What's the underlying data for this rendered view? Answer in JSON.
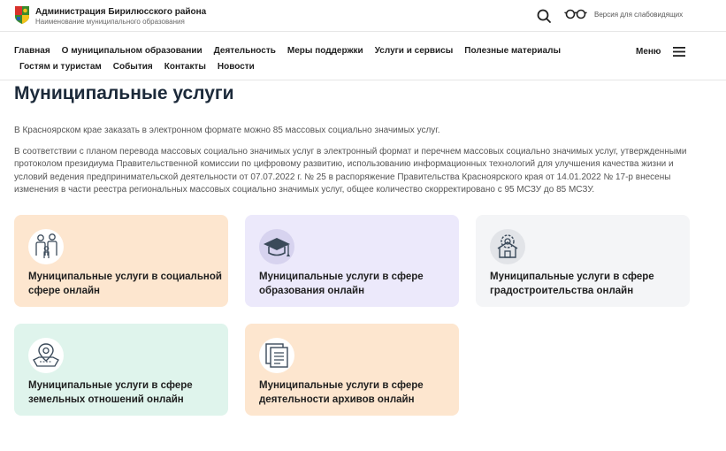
{
  "header": {
    "org_name": "Администрация Бирилюсского района",
    "org_subtitle": "Наименование муниципального образования",
    "accessibility_label": "Версия для слабовидящих"
  },
  "nav": {
    "row1": [
      "Главная",
      "О муниципальном образовании",
      "Деятельность",
      "Меры поддержки",
      "Услуги и сервисы",
      "Полезные материалы"
    ],
    "row2": [
      "Гостям и туристам",
      "События",
      "Контакты",
      "Новости"
    ],
    "menu_label": "Меню"
  },
  "main": {
    "title": "Муниципальные услуги",
    "intro": "В Красноярском крае заказать в электронном формате можно  85 массовых социально значимых услуг.",
    "paragraph": "В соответствии с планом перевода массовых социально значимых услуг в электронный формат и перечнем массовых социально значимых услуг, утвержденными протоколом президиума Правительственной комиссии по цифровому развитию, использованию информационных технологий для улучшения качества жизни и условий ведения предпринимательской деятельности от 07.07.2022 г. № 25 в распоряжение Правительства Красноярского края от 14.01.2022 № 17-р внесены изменения в части реестра региональных массовых социально значимых услуг, общее количество скорректировано с 95 МСЗУ до 85 МСЗУ.",
    "cards": [
      {
        "label": "Муниципальные услуги в социальной сфере онлайн",
        "icon": "family-icon",
        "color": "#fde6cf"
      },
      {
        "label": "Муниципальные услуги в сфере образования онлайн",
        "icon": "graduation-cap-icon",
        "color": "#ece9fb"
      },
      {
        "label": "Муниципальные услуги в сфере градостроительства онлайн",
        "icon": "house-gear-icon",
        "color": "#f4f5f7"
      },
      {
        "label": "Муниципальные услуги в сфере земельных отношений онлайн",
        "icon": "land-plot-icon",
        "color": "#dff4ec"
      },
      {
        "label": "Муниципальные услуги в сфере деятельности архивов онлайн",
        "icon": "archive-documents-icon",
        "color": "#fde6cf"
      }
    ]
  }
}
